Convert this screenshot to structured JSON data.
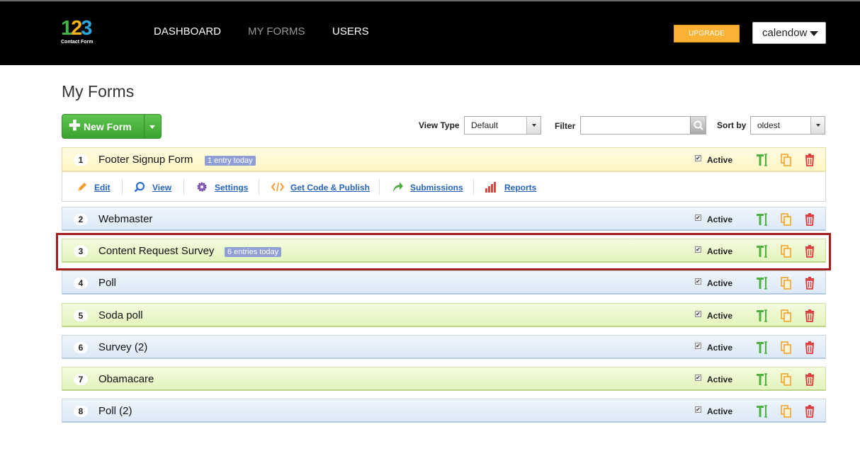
{
  "brand": {
    "digits": [
      "1",
      "2",
      "3"
    ],
    "subtitle": "Contact Form"
  },
  "nav": [
    {
      "label": "DASHBOARD",
      "current": false
    },
    {
      "label": "MY FORMS",
      "current": true
    },
    {
      "label": "USERS",
      "current": false
    }
  ],
  "upgrade_label": "UPGRADE",
  "user": {
    "name": "calendow"
  },
  "page_title": "My Forms",
  "new_form_label": "New Form",
  "controls": {
    "view_type_label": "View Type",
    "view_type_value": "Default",
    "filter_label": "Filter",
    "filter_value": "",
    "sort_label": "Sort by",
    "sort_value": "oldest"
  },
  "actions": [
    {
      "label": "Edit",
      "icon": "pencil-icon"
    },
    {
      "label": "View",
      "icon": "magnifier-icon"
    },
    {
      "label": "Settings",
      "icon": "gear-icon"
    },
    {
      "label": "Get Code & Publish",
      "icon": "code-icon"
    },
    {
      "label": "Submissions",
      "icon": "arrow-icon"
    },
    {
      "label": "Reports",
      "icon": "bar-chart-icon"
    }
  ],
  "forms": [
    {
      "num": "1",
      "name": "Footer Signup Form",
      "badge": "1 entry today",
      "status": "Active",
      "checked": true,
      "color": "yellow"
    },
    {
      "num": "2",
      "name": "Webmaster",
      "badge": "",
      "status": "Active",
      "checked": true,
      "color": "blue"
    },
    {
      "num": "3",
      "name": "Content Request Survey",
      "badge": "6 entries today",
      "status": "Active",
      "checked": true,
      "color": "green"
    },
    {
      "num": "4",
      "name": "Poll",
      "badge": "",
      "status": "Active",
      "checked": true,
      "color": "blue"
    },
    {
      "num": "5",
      "name": "Soda poll",
      "badge": "",
      "status": "Active",
      "checked": true,
      "color": "green"
    },
    {
      "num": "6",
      "name": "Survey (2)",
      "badge": "",
      "status": "Active",
      "checked": true,
      "color": "blue"
    },
    {
      "num": "7",
      "name": "Obamacare",
      "badge": "",
      "status": "Active",
      "checked": true,
      "color": "green"
    },
    {
      "num": "8",
      "name": "Poll (2)",
      "badge": "",
      "status": "Active",
      "checked": true,
      "color": "blue"
    }
  ],
  "colors": {
    "accent_green": "#43b649",
    "upgrade": "#f9b234",
    "highlight": "#a51c1c",
    "link": "#2563b8"
  }
}
